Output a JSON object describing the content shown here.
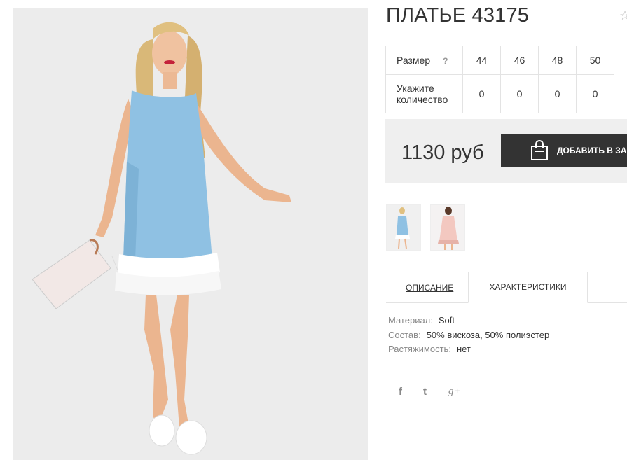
{
  "product": {
    "title": "ПЛАТЬЕ 43175",
    "star": "☆"
  },
  "sizes": {
    "size_label": "Размер",
    "help_mark": "?",
    "qty_label_line1": "Укажите",
    "qty_label_line2": "количество",
    "values": [
      "44",
      "46",
      "48",
      "50"
    ],
    "quantities": [
      "0",
      "0",
      "0",
      "0"
    ]
  },
  "price": {
    "amount": "1130 руб",
    "add_to_cart": "ДОБАВИТЬ В ЗАКАЗ"
  },
  "tabs": {
    "description": "ОПИСАНИЕ",
    "characteristics": "ХАРАКТЕРИСТИКИ"
  },
  "specs": [
    {
      "key": "Материал:",
      "value": "Soft"
    },
    {
      "key": "Состав:",
      "value": "50% вискоза, 50% полиэстер"
    },
    {
      "key": "Растяжимость:",
      "value": "нет"
    }
  ],
  "social": {
    "facebook": "f",
    "twitter": "t",
    "google": "g+"
  },
  "colors": {
    "dress_blue": "#8fc1e3",
    "dress_pink": "#f3c8c0",
    "button_dark": "#333333",
    "price_bg": "#efefef"
  }
}
